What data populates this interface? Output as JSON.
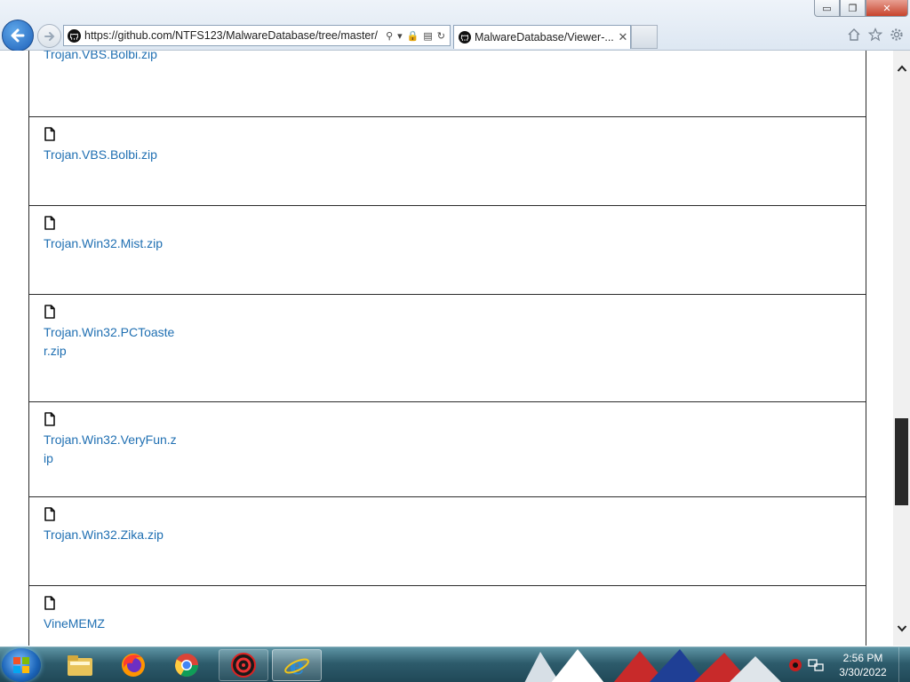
{
  "window": {
    "minimize_label": "▭",
    "restore_label": "❐",
    "close_label": "✕"
  },
  "browser": {
    "address_url": "https://github.com/NTFS123/MalwareDatabase/tree/master/",
    "tab_title": "MalwareDatabase/Viewer-...",
    "tab_close": "✕"
  },
  "files": [
    {
      "name": "Trojan.VBS.Bolbi.zip",
      "row_height": 0
    },
    {
      "name": "Trojan.VBS.Bolbi.zip"
    },
    {
      "name": "Trojan.Win32.Mist.zip"
    },
    {
      "name": "Trojan.Win32.PCToaster.zip"
    },
    {
      "name": "Trojan.Win32.VeryFun.zip"
    },
    {
      "name": "Trojan.Win32.Zika.zip"
    },
    {
      "name": "VineMEMZ"
    }
  ],
  "taskbar": {
    "apps": [
      "windows-explorer",
      "firefox",
      "chrome",
      "malware-app",
      "internet-explorer"
    ],
    "clock_time": "2:56 PM",
    "clock_date": "3/30/2022"
  },
  "colors": {
    "link": "#1f6fb2",
    "border": "#2b2b2b",
    "taskbar": "#2d5b6b"
  }
}
